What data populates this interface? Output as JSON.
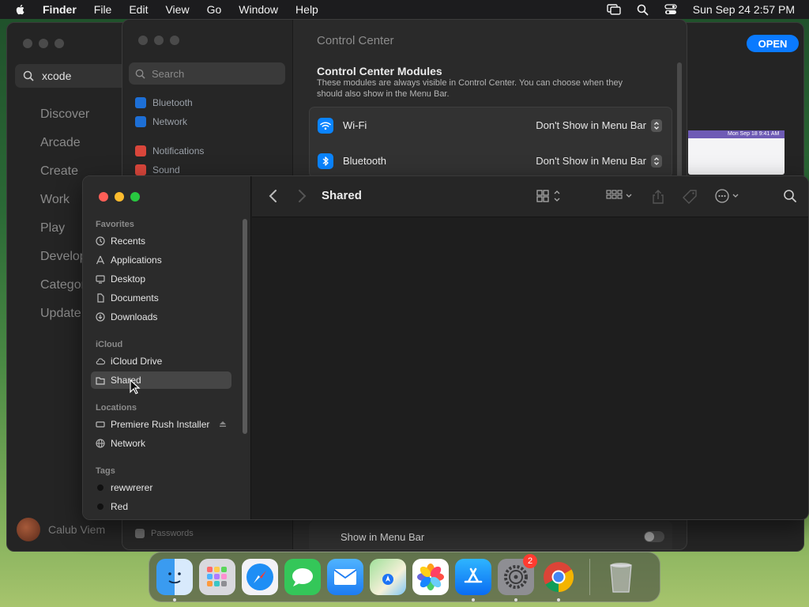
{
  "menubar": {
    "app_name": "Finder",
    "menus": [
      "File",
      "Edit",
      "View",
      "Go",
      "Window",
      "Help"
    ],
    "clock": "Sun Sep 24  2:57 PM"
  },
  "appstore": {
    "search_value": "xcode",
    "nav": [
      "Discover",
      "Arcade",
      "Create",
      "Work",
      "Play",
      "Develop",
      "Categor",
      "Update"
    ],
    "open_label": "OPEN",
    "user_name": "Calub Viem",
    "thumb_caption": "Mon Sep 18  9:41 AM"
  },
  "settings": {
    "search_placeholder": "Search",
    "sidebar": [
      "Bluetooth",
      "Network",
      "Notifications",
      "Sound",
      "Passwords"
    ],
    "title": "Control Center",
    "section_title": "Control Center Modules",
    "section_desc": "These modules are always visible in Control Center. You can choose when they should also show in the Menu Bar.",
    "rows": [
      {
        "label": "Wi-Fi",
        "value": "Don't Show in Menu Bar"
      },
      {
        "label": "Bluetooth",
        "value": "Don't Show in Menu Bar"
      }
    ],
    "bottom_row": "Show in Menu Bar"
  },
  "finder": {
    "title": "Shared",
    "groups": {
      "favorites": "Favorites",
      "icloud": "iCloud",
      "locations": "Locations",
      "tags": "Tags"
    },
    "favorites": [
      "Recents",
      "Applications",
      "Desktop",
      "Documents",
      "Downloads"
    ],
    "icloud": [
      "iCloud Drive",
      "Shared"
    ],
    "locations": [
      "Premiere Rush Installer",
      "Network"
    ],
    "tags": [
      "rewwrerer",
      "Red"
    ],
    "selected": "Shared"
  },
  "dock": {
    "apps": [
      "finder-icon",
      "launchpad-icon",
      "safari-icon",
      "messages-icon",
      "mail-icon",
      "maps-icon",
      "photos-icon",
      "app-store-icon",
      "system-settings-icon",
      "chrome-icon"
    ],
    "settings_badge": "2"
  },
  "colors": {
    "accent": "#0a7aff",
    "red_tag": "#ff5f57",
    "badge": "#ff3b30"
  }
}
